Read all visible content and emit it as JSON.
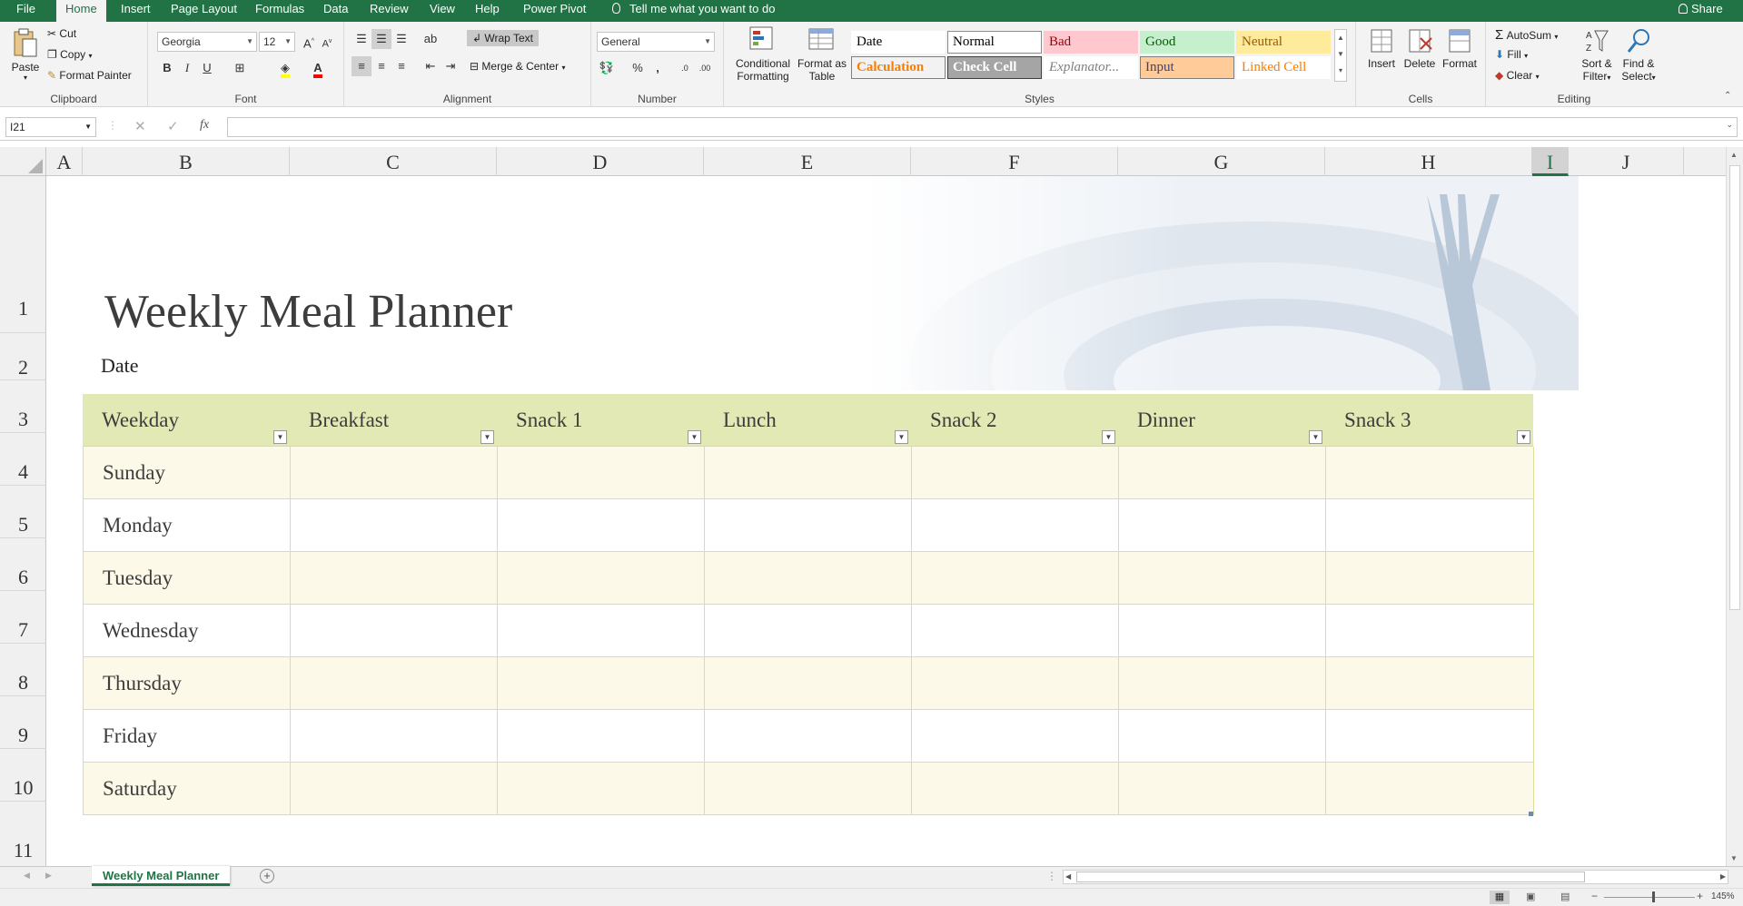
{
  "ribbon_tabs": [
    "File",
    "Home",
    "Insert",
    "Page Layout",
    "Formulas",
    "Data",
    "Review",
    "View",
    "Help",
    "Power Pivot"
  ],
  "tell_me": "Tell me what you want to do",
  "share": "Share",
  "clipboard": {
    "paste": "Paste",
    "cut": "Cut",
    "copy": "Copy",
    "format_painter": "Format Painter",
    "label": "Clipboard"
  },
  "font": {
    "name": "Georgia",
    "size": "12",
    "label": "Font"
  },
  "alignment": {
    "wrap": "Wrap Text",
    "merge": "Merge & Center",
    "label": "Alignment"
  },
  "number": {
    "format": "General",
    "label": "Number"
  },
  "styles": {
    "conditional": "Conditional",
    "conditional2": "Formatting",
    "format_as": "Format as",
    "format_as2": "Table",
    "label": "Styles",
    "cells": [
      {
        "text": "Date",
        "bg": "#ffffff",
        "fg": "#000000",
        "border": "#ffffff"
      },
      {
        "text": "Normal",
        "bg": "#ffffff",
        "fg": "#000000",
        "border": "#8c8c8c"
      },
      {
        "text": "Bad",
        "bg": "#ffc7ce",
        "fg": "#9c0006",
        "border": "#ffc7ce"
      },
      {
        "text": "Good",
        "bg": "#c6efce",
        "fg": "#006100",
        "border": "#c6efce"
      },
      {
        "text": "Neutral",
        "bg": "#ffeb9c",
        "fg": "#9c5700",
        "border": "#ffeb9c"
      },
      {
        "text": "Calculation",
        "bg": "#f2f2f2",
        "fg": "#fa7d00",
        "border": "#7f7f7f"
      },
      {
        "text": "Check Cell",
        "bg": "#a5a5a5",
        "fg": "#ffffff",
        "border": "#3f3f3f"
      },
      {
        "text": "Explanator...",
        "bg": "#ffffff",
        "fg": "#7f7f7f",
        "border": "#ffffff"
      },
      {
        "text": "Input",
        "bg": "#ffcc99",
        "fg": "#3f3f76",
        "border": "#7f7f7f"
      },
      {
        "text": "Linked Cell",
        "bg": "#ffffff",
        "fg": "#fa7d00",
        "border": "#ffffff"
      }
    ]
  },
  "cells_group": {
    "insert": "Insert",
    "delete": "Delete",
    "format": "Format",
    "label": "Cells"
  },
  "editing": {
    "autosum": "AutoSum",
    "fill": "Fill",
    "clear": "Clear",
    "sort1": "Sort &",
    "sort2": "Filter",
    "find1": "Find &",
    "find2": "Select",
    "label": "Editing"
  },
  "namebox": "I21",
  "fx": "fx",
  "columns": [
    "A",
    "B",
    "C",
    "D",
    "E",
    "F",
    "G",
    "H",
    "I",
    "J"
  ],
  "rows": [
    "1",
    "2",
    "3",
    "4",
    "5",
    "6",
    "7",
    "8",
    "9",
    "10",
    "11"
  ],
  "sheet_title": "Weekly Meal Planner",
  "date_label": "Date",
  "table_headers": [
    "Weekday",
    "Breakfast",
    "Snack 1",
    "Lunch",
    "Snack 2",
    "Dinner",
    "Snack 3"
  ],
  "weekdays": [
    "Sunday",
    "Monday",
    "Tuesday",
    "Wednesday",
    "Thursday",
    "Friday",
    "Saturday"
  ],
  "sheet_tab": "Weekly Meal Planner",
  "zoom": "145%",
  "colors": {
    "excel_green": "#217346",
    "header_fill": "#e3e9b4",
    "band_fill": "#fdf9e8"
  }
}
